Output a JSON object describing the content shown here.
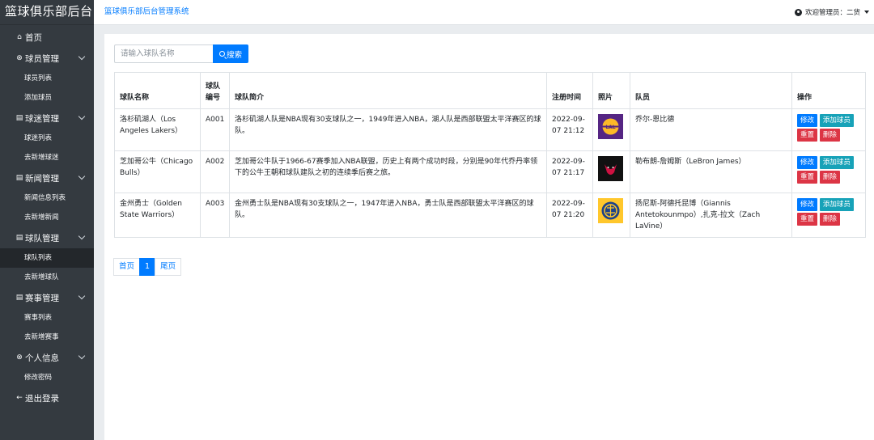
{
  "sidebar": {
    "brand": "篮球俱乐部后台",
    "home": "首页",
    "menus": [
      {
        "label": "球员管理",
        "items": [
          "球员列表",
          "添加球员"
        ]
      },
      {
        "label": "球迷管理",
        "items": [
          "球迷列表",
          "去新增球迷"
        ]
      },
      {
        "label": "新闻管理",
        "items": [
          "新闻信息列表",
          "去新增新闻"
        ]
      },
      {
        "label": "球队管理",
        "items": [
          "球队列表",
          "去新增球队"
        ]
      },
      {
        "label": "赛事管理",
        "items": [
          "赛事列表",
          "去新增赛事"
        ]
      },
      {
        "label": "个人信息",
        "items": [
          "修改密码"
        ]
      }
    ],
    "logout": "退出登录"
  },
  "header": {
    "title": "篮球俱乐部后台管理系统",
    "user": "欢迎管理员：二货"
  },
  "search": {
    "placeholder": "请输入球队名称",
    "button": "搜索"
  },
  "table": {
    "headers": [
      "球队名称",
      "球队编号",
      "球队简介",
      "注册时间",
      "照片",
      "队员",
      "操作"
    ],
    "rows": [
      {
        "name": "洛杉矶湖人（Los Angeles Lakers）",
        "code": "A001",
        "intro": "洛杉矶湖人队是NBA现有30支球队之一，1949年进入NBA，湖人队是西部联盟太平洋赛区的球队。",
        "time": "2022-09-07 21:12",
        "logo_color": "#552583",
        "players": "乔尔-恩比德"
      },
      {
        "name": "芝加哥公牛（Chicago Bulls）",
        "code": "A002",
        "intro": "芝加哥公牛队于1966-67赛季加入NBA联盟，历史上有两个成功时段，分别是90年代乔丹率领下的公牛王朝和球队建队之初的连续季后赛之旅。",
        "time": "2022-09-07 21:17",
        "logo_color": "#111111",
        "players": "勒布朗-詹姆斯（LeBron James）"
      },
      {
        "name": "金州勇士（Golden State Warriors）",
        "code": "A003",
        "intro": "金州勇士队是NBA现有30支球队之一，1947年进入NBA，勇士队是西部联盟太平洋赛区的球队。",
        "time": "2022-09-07 21:20",
        "logo_color": "#1D428A",
        "players": "扬尼斯-阿德托昆博（Giannis Antetokounmpo）,扎克-拉文（Zach LaVine）"
      }
    ],
    "actions": {
      "edit": "修改",
      "add_player": "添加球员",
      "reset": "重置",
      "delete": "删除"
    }
  },
  "pager": {
    "first": "首页",
    "current": "1",
    "last": "尾页"
  }
}
